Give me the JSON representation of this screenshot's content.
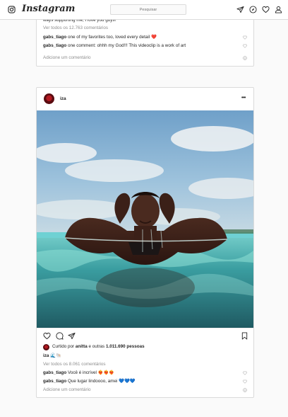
{
  "topbar": {
    "logo_text": "Instagram",
    "search_placeholder": "Pesquisar",
    "icons": [
      "instagram-glyph-icon",
      "direct-icon",
      "explore-icon",
      "heart-icon",
      "profile-icon"
    ]
  },
  "post1": {
    "caption_tail": "ways supporting me, I love you guys!",
    "view_all": "Ver todos os 12.763 comentários",
    "comments": [
      {
        "user": "gabs_tiago",
        "text": "one of my favorites too, loved every detail ❤️"
      },
      {
        "user": "gabs_tiago",
        "text": "one comment: ohhh my God!!! This videoclip is a work of art"
      }
    ],
    "add_comment": "Adicione um comentário"
  },
  "post2": {
    "username": "iza",
    "more": "•••",
    "liked_prefix": "Curtido por",
    "liked_user": "anitta",
    "liked_connector": "e outras",
    "liked_count": "1.011.690 pessoas",
    "caption_user": "iza",
    "caption_text": "🌊🐚",
    "view_all": "Ver todos os 8.061 comentários",
    "comments": [
      {
        "user": "gabs_tiago",
        "text": "Você é incrível ❤️‍🔥❤️‍🔥❤️‍🔥"
      },
      {
        "user": "gabs_tiago",
        "text": "Que lugar lindoooo, amei 💙💙💙"
      }
    ],
    "add_comment": "Adicione um comentário",
    "photo_alt": "woman in a pool with hands behind her head"
  },
  "colors": {
    "text": "#262626",
    "muted": "#8e8e8e",
    "border": "#dbdbdb",
    "bg": "#fafafa"
  }
}
